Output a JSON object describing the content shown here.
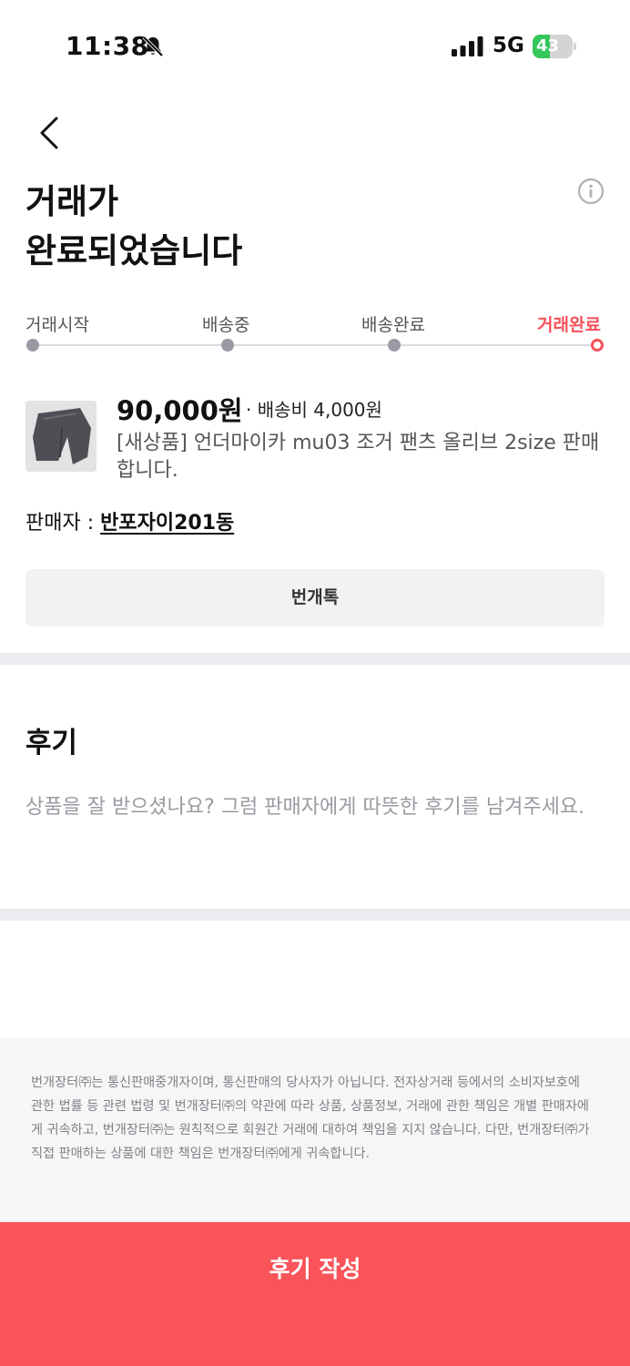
{
  "status_bar": {
    "time": "11:38",
    "network": "5G",
    "battery_level": "43",
    "battery_fill_percent": 43,
    "battery_color": "#34c759"
  },
  "header": {
    "title_line1": "거래가",
    "title_line2": "완료되었습니다"
  },
  "progress": {
    "steps": [
      {
        "label": "거래시작",
        "active": false
      },
      {
        "label": "배송중",
        "active": false
      },
      {
        "label": "배송완료",
        "active": false
      },
      {
        "label": "거래완료",
        "active": true
      }
    ],
    "active_color": "#f5505a"
  },
  "product": {
    "price": "90,000원",
    "shipping": "· 배송비 4,000원",
    "title": "[새상품] 언더마이카 mu03 조거 팬츠 올리브 2size 판매 합니다."
  },
  "seller": {
    "label": "판매자 : ",
    "name": "반포자이201동"
  },
  "chat_button_label": "번개톡",
  "review": {
    "heading": "후기",
    "prompt": "상품을 잘 받으셨나요? 그럼 판매자에게 따뜻한 후기를 남겨주세요."
  },
  "disclaimer": "번개장터㈜는 통신판매중개자이며, 통신판매의 당사자가 아닙니다. 전자상거래 등에서의 소비자보호에 관한 법률 등 관련 법령 및 번개장터㈜의 약관에 따라 상품, 상품정보, 거래에 관한 책임은 개별 판매자에게 귀속하고, 번개장터㈜는 원칙적으로 회원간 거래에 대하여 책임을 지지 않습니다. 다만, 번개장터㈜가 직접 판매하는 상품에 대한 책임은 번개장터㈜에게 귀속합니다.",
  "write_review_button": "후기 작성",
  "colors": {
    "accent": "#f9545a",
    "divider": "#ebebf0"
  },
  "icons": [
    "bell-slash-icon",
    "signal-icon",
    "battery-icon",
    "back-arrow-icon",
    "info-icon"
  ]
}
